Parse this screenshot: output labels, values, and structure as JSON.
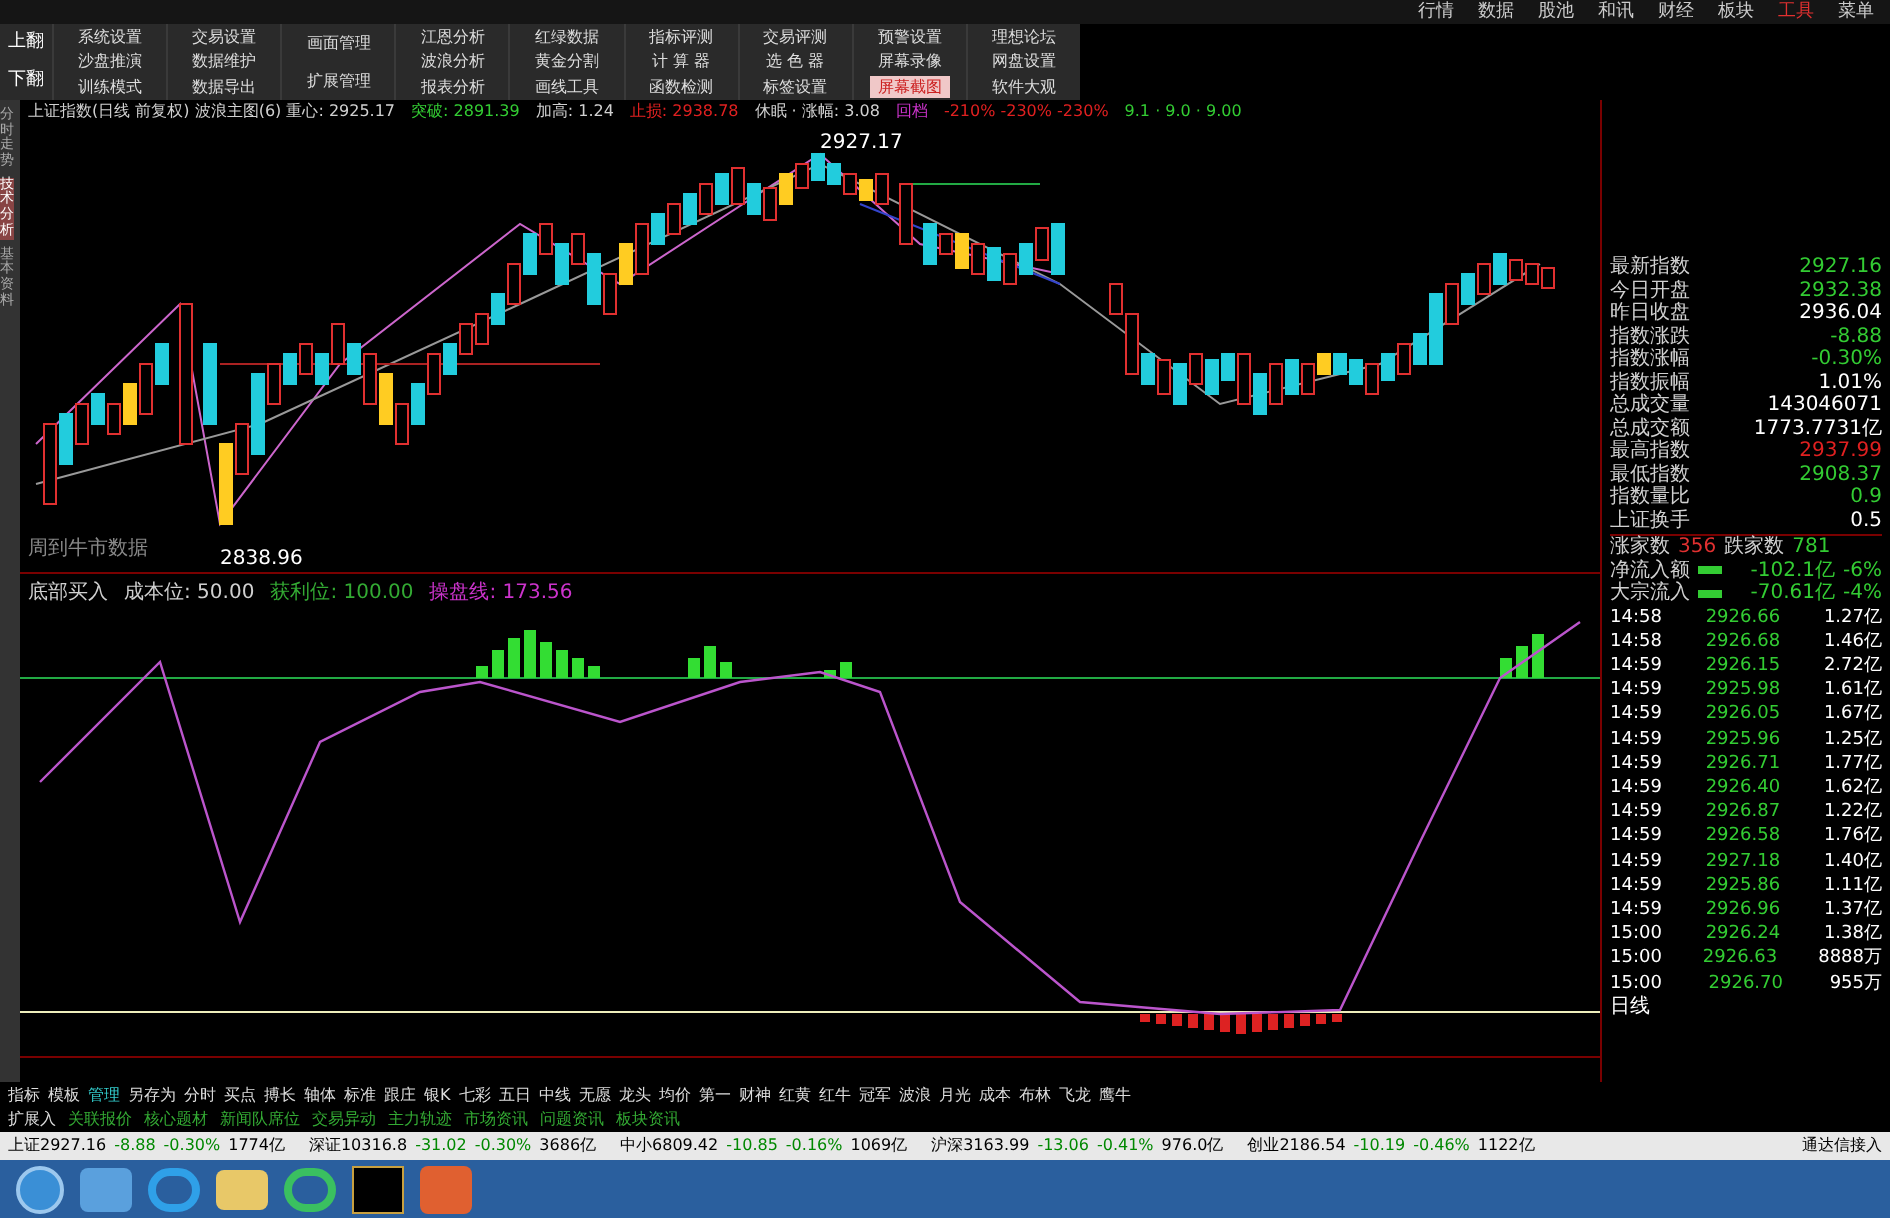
{
  "top_menu": [
    {
      "label": "行情",
      "selected": false
    },
    {
      "label": "数据",
      "selected": false
    },
    {
      "label": "股池",
      "selected": false
    },
    {
      "label": "和讯",
      "selected": false
    },
    {
      "label": "财经",
      "selected": false
    },
    {
      "label": "板块",
      "selected": false
    },
    {
      "label": "工具",
      "selected": true
    },
    {
      "label": "菜单",
      "selected": false
    }
  ],
  "page_buttons": [
    "上翻",
    "下翻"
  ],
  "toolbar_columns": [
    {
      "items": [
        {
          "label": "系统设置",
          "selected": false
        },
        {
          "label": "沙盘推演",
          "selected": false
        },
        {
          "label": "训练模式",
          "selected": false
        }
      ]
    },
    {
      "items": [
        {
          "label": "交易设置",
          "selected": false
        },
        {
          "label": "数据维护",
          "selected": false
        },
        {
          "label": "数据导出",
          "selected": false
        }
      ]
    },
    {
      "items": [
        {
          "label": "画面管理",
          "selected": false
        },
        {
          "label": "扩展管理",
          "selected": false
        }
      ]
    },
    {
      "items": [
        {
          "label": "江恩分析",
          "selected": false
        },
        {
          "label": "波浪分析",
          "selected": false
        },
        {
          "label": "报表分析",
          "selected": false
        }
      ]
    },
    {
      "items": [
        {
          "label": "红绿数据",
          "selected": false
        },
        {
          "label": "黄金分割",
          "selected": false
        },
        {
          "label": "画线工具",
          "selected": false
        }
      ]
    },
    {
      "items": [
        {
          "label": "指标评测",
          "selected": false
        },
        {
          "label": "计 算 器",
          "selected": false
        },
        {
          "label": "函数检测",
          "selected": false
        }
      ]
    },
    {
      "items": [
        {
          "label": "交易评测",
          "selected": false
        },
        {
          "label": "选 色 器",
          "selected": false
        },
        {
          "label": "标签设置",
          "selected": false
        }
      ]
    },
    {
      "items": [
        {
          "label": "预警设置",
          "selected": false
        },
        {
          "label": "屏幕录像",
          "selected": false
        },
        {
          "label": "屏幕截图",
          "selected": true
        }
      ]
    },
    {
      "items": [
        {
          "label": "理想论坛",
          "selected": false
        },
        {
          "label": "网盘设置",
          "selected": false
        },
        {
          "label": "软件大观",
          "selected": false
        }
      ]
    }
  ],
  "side_tabs": [
    {
      "label": "分时走势",
      "selected": false
    },
    {
      "label": "技术分析",
      "selected": true
    },
    {
      "label": "基本资料",
      "selected": false
    }
  ],
  "chart_header": [
    {
      "text": "上证指数(日线 前复权) 波浪主图(6) 重心: 2925.17",
      "color": "#d0d0d0"
    },
    {
      "text": "突破: 2891.39",
      "color": "#33cc33"
    },
    {
      "text": "加高: 1.24",
      "color": "#d0d0d0"
    },
    {
      "text": "止损: 2938.78",
      "color": "#e02020"
    },
    {
      "text": "休眠 · 涨幅: 3.08",
      "color": "#d0d0d0"
    },
    {
      "text": "回档",
      "color": "#cc33cc"
    },
    {
      "text": "-210% -230% -230%",
      "color": "#e02020"
    },
    {
      "text": "9.1 · 9.0 · 9.00",
      "color": "#33cc33"
    }
  ],
  "chart_labels": {
    "high": "2927.17",
    "low": "2838.96",
    "note": "周到牛市数据"
  },
  "indicator_header": [
    {
      "text": "底部买入",
      "color": "#d0d0d0"
    },
    {
      "text": "成本位: 50.00",
      "color": "#d0d0d0"
    },
    {
      "text": "获利位: 100.00",
      "color": "#33aa33"
    },
    {
      "text": "操盘线: 173.56",
      "color": "#cc33cc"
    }
  ],
  "quote_panel": [
    {
      "label": "最新指数",
      "value": "2927.16",
      "color": "#33cc33"
    },
    {
      "label": "今日开盘",
      "value": "2932.38",
      "color": "#33cc33"
    },
    {
      "label": "昨日收盘",
      "value": "2936.04",
      "color": "#ffffff"
    },
    {
      "label": "指数涨跌",
      "value": "-8.88",
      "color": "#33cc33"
    },
    {
      "label": "指数涨幅",
      "value": "-0.30%",
      "color": "#33cc33"
    },
    {
      "label": "指数振幅",
      "value": "1.01%",
      "color": "#ffffff"
    },
    {
      "label": "总成交量",
      "value": "143046071",
      "color": "#ffffff"
    },
    {
      "label": "总成交额",
      "value": "1773.7731亿",
      "color": "#ffffff"
    },
    {
      "label": "最高指数",
      "value": "2937.99",
      "color": "#e02020"
    },
    {
      "label": "最低指数",
      "value": "2908.37",
      "color": "#33cc33"
    },
    {
      "label": "指数量比",
      "value": "0.9",
      "color": "#33cc33"
    },
    {
      "label": "上证换手",
      "value": "0.5",
      "color": "#ffffff"
    }
  ],
  "breadth": {
    "up_label": "涨家数",
    "up_value": "356",
    "down_label": "跌家数",
    "down_value": "781"
  },
  "flows": [
    {
      "label": "净流入额",
      "value": "-102.1亿",
      "pct": "-6%"
    },
    {
      "label": "大宗流入",
      "value": "-70.61亿",
      "pct": "-4%"
    }
  ],
  "ticks": [
    {
      "time": "14:58",
      "price": "2926.66",
      "amount": "1.27亿"
    },
    {
      "time": "14:58",
      "price": "2926.68",
      "amount": "1.46亿"
    },
    {
      "time": "14:59",
      "price": "2926.15",
      "amount": "2.72亿"
    },
    {
      "time": "14:59",
      "price": "2925.98",
      "amount": "1.61亿"
    },
    {
      "time": "14:59",
      "price": "2926.05",
      "amount": "1.67亿"
    },
    {
      "time": "14:59",
      "price": "2925.96",
      "amount": "1.25亿"
    },
    {
      "time": "14:59",
      "price": "2926.71",
      "amount": "1.77亿"
    },
    {
      "time": "14:59",
      "price": "2926.40",
      "amount": "1.62亿"
    },
    {
      "time": "14:59",
      "price": "2926.87",
      "amount": "1.22亿"
    },
    {
      "time": "14:59",
      "price": "2926.58",
      "amount": "1.76亿"
    },
    {
      "time": "14:59",
      "price": "2927.18",
      "amount": "1.40亿"
    },
    {
      "time": "14:59",
      "price": "2925.86",
      "amount": "1.11亿"
    },
    {
      "time": "14:59",
      "price": "2926.96",
      "amount": "1.37亿"
    },
    {
      "time": "15:00",
      "price": "2926.24",
      "amount": "1.38亿"
    },
    {
      "time": "15:00",
      "price": "2926.63",
      "amount": "8888万"
    },
    {
      "time": "15:00",
      "price": "2926.70",
      "amount": "955万"
    }
  ],
  "period_label": "日线",
  "indicator_tabs": [
    {
      "label": "指标",
      "selected": false
    },
    {
      "label": "模板",
      "selected": false
    },
    {
      "label": "管理",
      "selected": true
    },
    {
      "label": "另存为",
      "selected": false
    },
    {
      "label": "分时",
      "selected": false
    },
    {
      "label": "买点",
      "selected": false
    },
    {
      "label": "搏长",
      "selected": false
    },
    {
      "label": "轴体",
      "selected": false
    },
    {
      "label": "标准",
      "selected": false
    },
    {
      "label": "跟庄",
      "selected": false
    },
    {
      "label": "银K",
      "selected": false
    },
    {
      "label": "七彩",
      "selected": false
    },
    {
      "label": "五日",
      "selected": false
    },
    {
      "label": "中线",
      "selected": false
    },
    {
      "label": "无愿",
      "selected": false
    },
    {
      "label": "龙头",
      "selected": false
    },
    {
      "label": "均价",
      "selected": false
    },
    {
      "label": "第一",
      "selected": false
    },
    {
      "label": "财神",
      "selected": false
    },
    {
      "label": "红黄",
      "selected": false
    },
    {
      "label": "红牛",
      "selected": false
    },
    {
      "label": "冠军",
      "selected": false
    },
    {
      "label": "波浪",
      "selected": false
    },
    {
      "label": "月光",
      "selected": false
    },
    {
      "label": "成本",
      "selected": false
    },
    {
      "label": "布林",
      "selected": false
    },
    {
      "label": "飞龙",
      "selected": false
    },
    {
      "label": "鹰牛",
      "selected": false
    }
  ],
  "info_tabs": [
    "扩展入",
    "关联报价",
    "核心题材",
    "新闻队席位",
    "交易异动",
    "主力轨迹",
    "市场资讯",
    "问题资讯",
    "板块资讯"
  ],
  "status_bar": [
    {
      "name": "上证2927.16",
      "change": "-8.88",
      "pct": "-0.30%",
      "amount": "1774亿"
    },
    {
      "name": "深证10316.8",
      "change": "-31.02",
      "pct": "-0.30%",
      "amount": "3686亿"
    },
    {
      "name": "中小6809.42",
      "change": "-10.85",
      "pct": "-0.16%",
      "amount": "1069亿"
    },
    {
      "name": "沪深3163.99",
      "change": "-13.06",
      "pct": "-0.41%",
      "amount": "976.0亿"
    },
    {
      "name": "创业2186.54",
      "change": "-10.19",
      "pct": "-0.46%",
      "amount": "1122亿"
    }
  ],
  "connection": "通达信接入"
}
